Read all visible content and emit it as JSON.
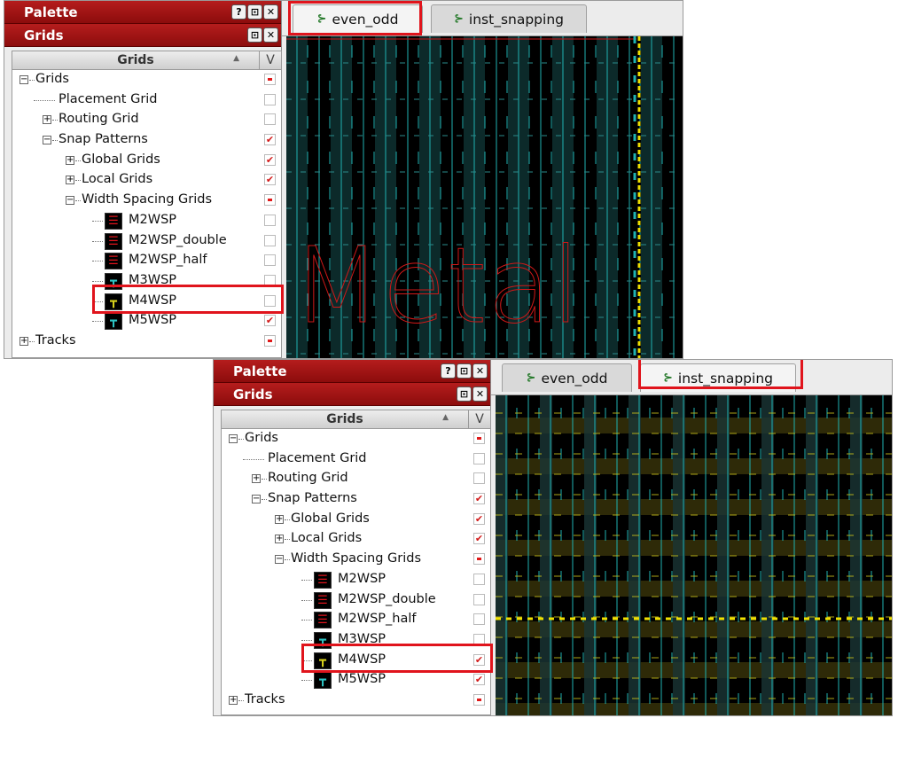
{
  "palette": {
    "title": "Palette",
    "buttons": [
      "?",
      "⊡",
      "✕"
    ],
    "sub_title": "Grids",
    "sub_buttons": [
      "⊡",
      "✕"
    ],
    "column_header": "Grids",
    "column_v": "V"
  },
  "tree": [
    {
      "label": "Grids",
      "level": 0,
      "expander": "−",
      "check": "partial"
    },
    {
      "label": "Placement Grid",
      "level": 1,
      "expander": "",
      "check": "empty"
    },
    {
      "label": "Routing Grid",
      "level": 1,
      "expander": "+",
      "check": "empty"
    },
    {
      "label": "Snap Patterns",
      "level": 1,
      "expander": "−",
      "check": "checked"
    },
    {
      "label": "Global Grids",
      "level": 2,
      "expander": "+",
      "check": "checked"
    },
    {
      "label": "Local Grids",
      "level": 2,
      "expander": "+",
      "check": "checked"
    },
    {
      "label": "Width Spacing Grids",
      "level": 2,
      "expander": "−",
      "check": "partial"
    },
    {
      "label": "M2WSP",
      "level": 3,
      "icon_color": "#e0141c",
      "check": "empty"
    },
    {
      "label": "M2WSP_double",
      "level": 3,
      "icon_color": "#e0141c",
      "check": "empty"
    },
    {
      "label": "M2WSP_half",
      "level": 3,
      "icon_color": "#e0141c",
      "check": "empty"
    },
    {
      "label": "M3WSP",
      "level": 3,
      "icon_color": "#2ec4c4",
      "check": "empty"
    },
    {
      "label": "M4WSP",
      "level": 3,
      "icon_color": "#d9d21c",
      "check": "empty"
    },
    {
      "label": "M5WSP",
      "level": 3,
      "icon_color": "#2ec4c4",
      "check": "checked"
    },
    {
      "label": "Tracks",
      "level": 0,
      "expander": "+",
      "check": "partial"
    }
  ],
  "bottom_checks": [
    "partial",
    "empty",
    "empty",
    "checked",
    "checked",
    "checked",
    "partial",
    "empty",
    "empty",
    "empty",
    "empty",
    "checked",
    "checked",
    "partial"
  ],
  "tabs": [
    {
      "label": "even_odd"
    },
    {
      "label": "inst_snapping"
    }
  ],
  "canvas_text": "Metal",
  "colors": {
    "titlebar": "#a01515",
    "highlight": "#e0141c",
    "track_cyan": "#1fb2b2",
    "track_yellow": "#c9c21a",
    "track_red": "#d01818",
    "check_red": "#d21a1a"
  }
}
